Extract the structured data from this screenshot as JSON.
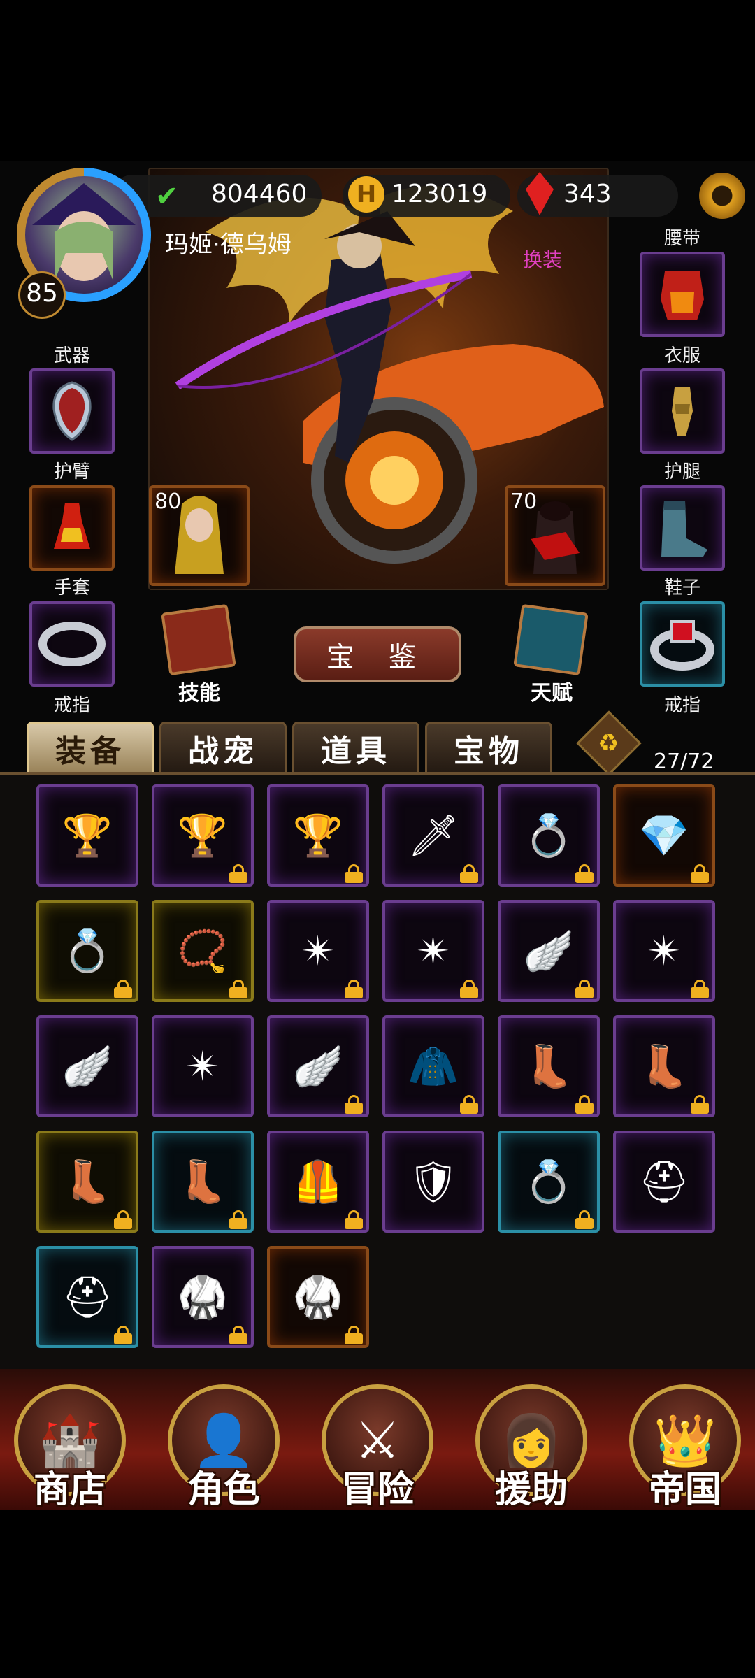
{
  "resources": {
    "power": "804460",
    "gold": "123019",
    "gems": "343"
  },
  "character": {
    "level": "85",
    "name": "玛姬·德乌姆",
    "change_outfit": "换装"
  },
  "equip_slots": {
    "weapon": "武器",
    "armguard": "护臂",
    "gloves": "手套",
    "ring_left": "戒指",
    "belt": "腰带",
    "clothes": "衣服",
    "legguard": "护腿",
    "shoes": "鞋子",
    "ring_right": "戒指"
  },
  "companions": {
    "left_level": "80",
    "right_level": "70"
  },
  "buttons": {
    "skills": "技能",
    "treasure_guide": "宝 鉴",
    "talent": "天赋"
  },
  "tabs": [
    "装备",
    "战宠",
    "道具",
    "宝物"
  ],
  "inventory": {
    "count": "27/72",
    "items": [
      {
        "icon": "golden-chalice-icon",
        "glyph": "🏆",
        "rarity": "purple",
        "locked": false
      },
      {
        "icon": "golden-goblet-icon",
        "glyph": "🏆",
        "rarity": "purple",
        "locked": true
      },
      {
        "icon": "golden-cup-icon",
        "glyph": "🏆",
        "rarity": "purple",
        "locked": true
      },
      {
        "icon": "sword-icon",
        "glyph": "🗡",
        "rarity": "purple",
        "locked": true
      },
      {
        "icon": "purple-bracelet-icon",
        "glyph": "💍",
        "rarity": "purple",
        "locked": true
      },
      {
        "icon": "blue-gem-pendant-icon",
        "glyph": "💎",
        "rarity": "orange",
        "locked": true
      },
      {
        "icon": "purple-bracelet-icon",
        "glyph": "💍",
        "rarity": "yellow",
        "locked": true
      },
      {
        "icon": "striped-necklace-icon",
        "glyph": "📿",
        "rarity": "yellow",
        "locked": true
      },
      {
        "icon": "star-amulet-icon",
        "glyph": "✴",
        "rarity": "purple",
        "locked": true
      },
      {
        "icon": "star-amulet-icon",
        "glyph": "✴",
        "rarity": "purple",
        "locked": true
      },
      {
        "icon": "winged-pendant-icon",
        "glyph": "🪽",
        "rarity": "purple",
        "locked": true
      },
      {
        "icon": "star-amulet-icon",
        "glyph": "✴",
        "rarity": "purple",
        "locked": true
      },
      {
        "icon": "winged-pendant-icon",
        "glyph": "🪽",
        "rarity": "purple",
        "locked": false
      },
      {
        "icon": "star-amulet-icon",
        "glyph": "✴",
        "rarity": "purple",
        "locked": false
      },
      {
        "icon": "winged-pendant-icon",
        "glyph": "🪽",
        "rarity": "purple",
        "locked": true
      },
      {
        "icon": "blue-cloak-icon",
        "glyph": "🧥",
        "rarity": "purple",
        "locked": true
      },
      {
        "icon": "armored-boot-icon",
        "glyph": "👢",
        "rarity": "purple",
        "locked": true
      },
      {
        "icon": "blue-boot-icon",
        "glyph": "👢",
        "rarity": "purple",
        "locked": true
      },
      {
        "icon": "leather-boots-icon",
        "glyph": "👢",
        "rarity": "yellow",
        "locked": true
      },
      {
        "icon": "leather-boots-icon",
        "glyph": "👢",
        "rarity": "blue",
        "locked": true
      },
      {
        "icon": "blue-vest-icon",
        "glyph": "🦺",
        "rarity": "purple",
        "locked": true
      },
      {
        "icon": "shield-icon",
        "glyph": "🛡",
        "rarity": "purple",
        "locked": false
      },
      {
        "icon": "ruby-ring-icon",
        "glyph": "💍",
        "rarity": "blue",
        "locked": true
      },
      {
        "icon": "golden-helmet-icon",
        "glyph": "⛑",
        "rarity": "purple",
        "locked": false
      },
      {
        "icon": "golden-helmet-icon",
        "glyph": "⛑",
        "rarity": "blue",
        "locked": true
      },
      {
        "icon": "golden-armor-icon",
        "glyph": "🥋",
        "rarity": "purple",
        "locked": true
      },
      {
        "icon": "white-armor-icon",
        "glyph": "🥋",
        "rarity": "orange",
        "locked": true
      }
    ]
  },
  "nav": [
    "商店",
    "角色",
    "冒险",
    "援助",
    "帝国"
  ],
  "colors": {
    "change_outfit": "#e040c0",
    "gold": "#f0b020",
    "purple_frame": "#6a3d8f",
    "blue_frame": "#2b8fa6"
  }
}
